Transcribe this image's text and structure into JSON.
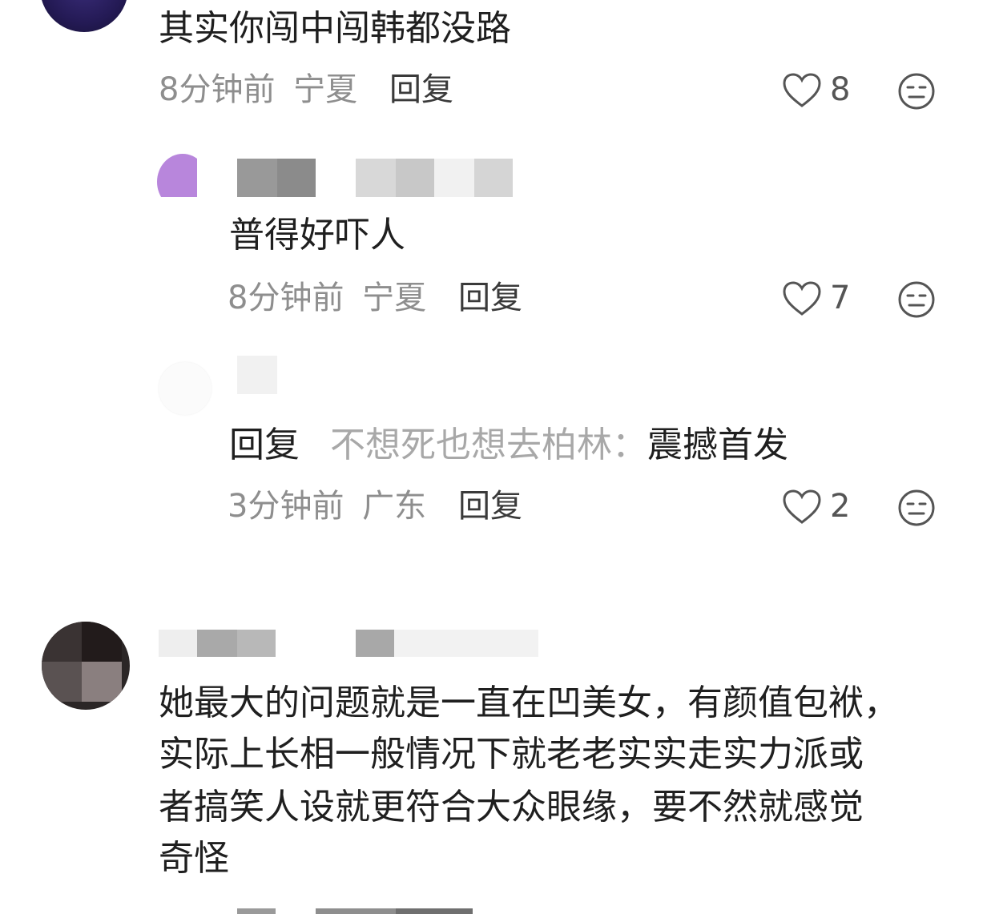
{
  "comments": [
    {
      "text": "其实你闯中闯韩都没路",
      "time": "8分钟前",
      "location": "宁夏",
      "reply_label": "回复",
      "likes": "8"
    },
    {
      "text": "普得好吓人",
      "time": "8分钟前",
      "location": "宁夏",
      "reply_label": "回复",
      "likes": "7"
    },
    {
      "reply_prefix": "回复",
      "reply_to": "不想死也想去柏林：",
      "text": "震撼首发",
      "time": "3分钟前",
      "location": "广东",
      "reply_label": "回复",
      "likes": "2"
    },
    {
      "lines": [
        "她最大的问题就是一直在凹美女，有颜值包袱，",
        "实际上长相一般情况下就老老实实走实力派或",
        "者搞笑人设就更符合大众眼缘，要不然就感觉",
        "奇怪"
      ]
    }
  ],
  "colors": {
    "text": "#1f1f1f",
    "meta": "#8e8e8e",
    "reply_to": "#a8a8a8",
    "avatar_purple": "#b886dc"
  },
  "icons": [
    "heart-icon",
    "expressionless-face-icon"
  ]
}
